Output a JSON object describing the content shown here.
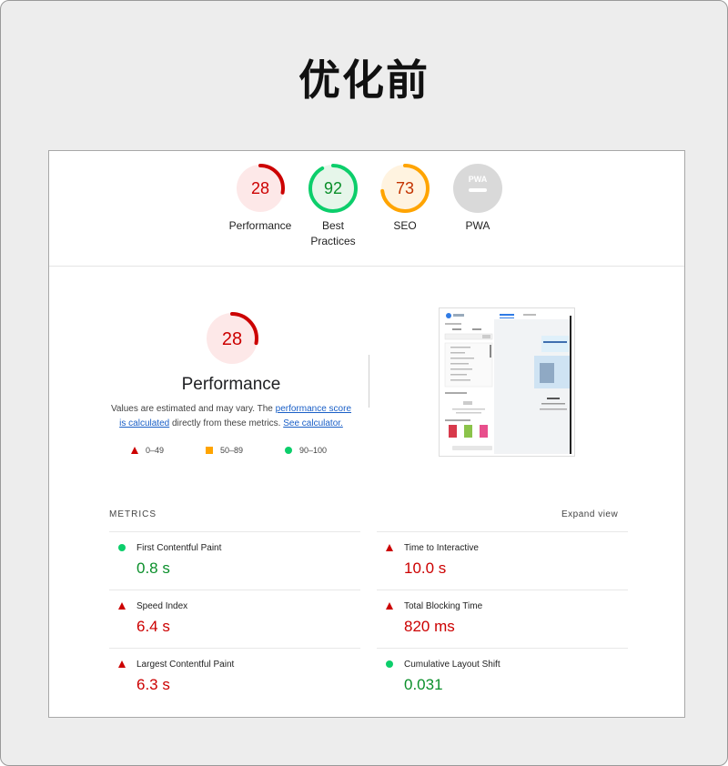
{
  "caption": "优化前",
  "colors": {
    "fail": "#cc0000",
    "average": "#ffa400",
    "pass": "#0cce6b",
    "na": "#bdbdbd"
  },
  "gauges": [
    {
      "score": "28",
      "label": "Performance",
      "level": "fail",
      "fraction": 0.28
    },
    {
      "score": "92",
      "label": "Best Practices",
      "level": "pass",
      "fraction": 0.92
    },
    {
      "score": "73",
      "label": "SEO",
      "level": "average",
      "fraction": 0.73
    },
    {
      "score": "",
      "label": "PWA",
      "level": "na",
      "fraction": 0
    }
  ],
  "pwa_badge": "PWA",
  "performance": {
    "score": "28",
    "fraction": 0.28,
    "title": "Performance",
    "desc_prefix": "Values are estimated and may vary. The ",
    "desc_link1": "performance score is calculated",
    "desc_middle": " directly from these metrics. ",
    "desc_link2": "See calculator."
  },
  "legend": [
    {
      "icon": "triangle-icon",
      "range": "0–49"
    },
    {
      "icon": "square-icon",
      "range": "50–89"
    },
    {
      "icon": "circle-icon",
      "range": "90–100"
    }
  ],
  "metrics_header": "METRICS",
  "expand_view": "Expand view",
  "metrics": [
    {
      "name": "First Contentful Paint",
      "value": "0.8 s",
      "level": "pass"
    },
    {
      "name": "Time to Interactive",
      "value": "10.0 s",
      "level": "fail"
    },
    {
      "name": "Speed Index",
      "value": "6.4 s",
      "level": "fail"
    },
    {
      "name": "Total Blocking Time",
      "value": "820 ms",
      "level": "fail"
    },
    {
      "name": "Largest Contentful Paint",
      "value": "6.3 s",
      "level": "fail"
    },
    {
      "name": "Cumulative Layout Shift",
      "value": "0.031",
      "level": "pass"
    }
  ]
}
